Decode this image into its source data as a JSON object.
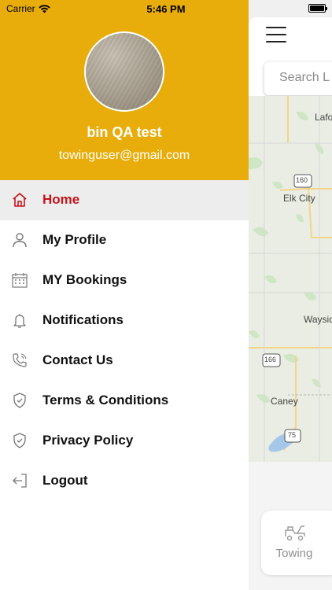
{
  "status_bar": {
    "carrier": "Carrier",
    "time": "5:46 PM"
  },
  "profile": {
    "name": "bin QA test",
    "email": "towinguser@gmail.com"
  },
  "menu": {
    "items": [
      {
        "label": "Home",
        "icon": "home-icon",
        "active": true
      },
      {
        "label": "My Profile",
        "icon": "user-icon"
      },
      {
        "label": "MY Bookings",
        "icon": "calendar-icon"
      },
      {
        "label": "Notifications",
        "icon": "bell-icon"
      },
      {
        "label": "Contact Us",
        "icon": "phone-icon"
      },
      {
        "label": "Terms & Conditions",
        "icon": "shield-check-icon"
      },
      {
        "label": "Privacy Policy",
        "icon": "shield-check-icon"
      },
      {
        "label": "Logout",
        "icon": "logout-icon"
      }
    ]
  },
  "map": {
    "search_placeholder": "Search L",
    "labels": {
      "lafo": "Lafo",
      "elk_city": "Elk City",
      "waysid": "Waysid",
      "caney": "Caney"
    },
    "route_shields": {
      "r160": "160",
      "r166": "166",
      "r75": "75"
    }
  },
  "service": {
    "label": "Towing"
  },
  "colors": {
    "header": "#e8ad0a",
    "active_text": "#c4151c",
    "active_bg": "#ededed"
  }
}
